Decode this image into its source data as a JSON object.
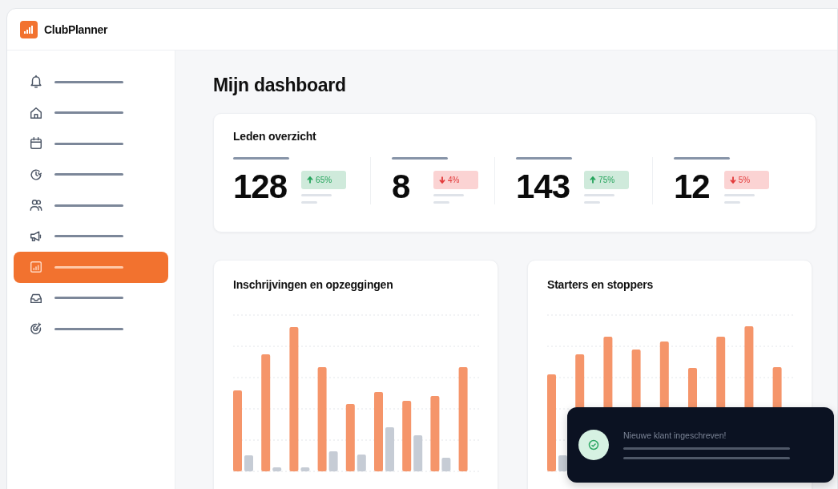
{
  "app": {
    "name": "ClubPlanner"
  },
  "sidebar": {
    "items": [
      {
        "selected": false
      },
      {
        "selected": false
      },
      {
        "selected": false
      },
      {
        "selected": false
      },
      {
        "selected": false
      },
      {
        "selected": false
      },
      {
        "selected": true
      },
      {
        "selected": false
      },
      {
        "selected": false
      }
    ]
  },
  "page_title": "Mijn dashboard",
  "members_card": {
    "title": "Leden overzicht",
    "stats": [
      {
        "value": "128",
        "change": "65%",
        "kind": "up"
      },
      {
        "value": "8",
        "change": "4%",
        "kind": "down"
      },
      {
        "value": "143",
        "change": "75%",
        "kind": "up"
      },
      {
        "value": "12",
        "change": "5%",
        "kind": "down"
      }
    ]
  },
  "charts": [
    {
      "title": "Inschrijvingen en opzeggingen"
    },
    {
      "title": "Starters en stoppers"
    }
  ],
  "toast": {
    "message": "Nieuwe klant ingeschreven!"
  }
}
